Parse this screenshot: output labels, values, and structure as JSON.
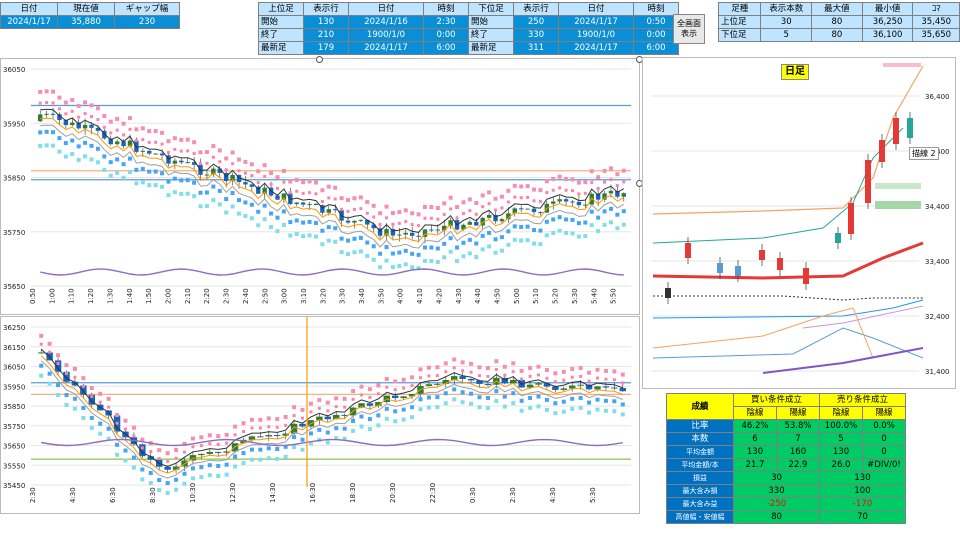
{
  "top_left": {
    "headers": [
      "日付",
      "現在値",
      "ギャップ幅"
    ],
    "values": [
      "2024/1/17",
      "35,880",
      "230"
    ]
  },
  "top_mid": {
    "headers": [
      "上位足",
      "表示行",
      "日付",
      "時刻",
      "下位足",
      "表示行",
      "日付",
      "時刻"
    ],
    "rows": [
      [
        "開始",
        "130",
        "2024/1/16",
        "2:30",
        "開始",
        "250",
        "2024/1/17",
        "0:50"
      ],
      [
        "終了",
        "210",
        "1900/1/0",
        "0:00",
        "終了",
        "330",
        "1900/1/0",
        "0:00"
      ],
      [
        "最新足",
        "179",
        "2024/1/17",
        "6:00",
        "最新足",
        "311",
        "2024/1/17",
        "6:00"
      ]
    ]
  },
  "fullscreen_button": "全画面表示",
  "top_right": {
    "headers": [
      "足種",
      "表示本数",
      "最大値",
      "最小値",
      "ｺﾏ"
    ],
    "rows": [
      [
        "上位足",
        "30",
        "80",
        "36,250",
        "35,450"
      ],
      [
        "下位足",
        "5",
        "80",
        "36,100",
        "35,650"
      ]
    ]
  },
  "chart1": {
    "y_ticks": [
      "36050",
      "35950",
      "35850",
      "35750",
      "35650"
    ],
    "x_ticks": [
      "0:50",
      "1:00",
      "1:10",
      "1:20",
      "1:30",
      "1:40",
      "1:50",
      "2:00",
      "2:10",
      "2:20",
      "2:30",
      "2:40",
      "2:50",
      "3:00",
      "3:10",
      "3:20",
      "3:30",
      "3:40",
      "3:50",
      "4:00",
      "4:10",
      "4:20",
      "4:30",
      "4:40",
      "4:50",
      "5:00",
      "5:10",
      "5:20",
      "5:30",
      "5:40",
      "5:50"
    ]
  },
  "chart2": {
    "y_ticks": [
      "36250",
      "36150",
      "36050",
      "35950",
      "35850",
      "35750",
      "35650",
      "35550",
      "35450"
    ],
    "x_ticks": [
      "2:30",
      "4:30",
      "6:30",
      "8:30",
      "10:30",
      "12:30",
      "14:30",
      "16:30",
      "18:30",
      "20:30",
      "22:30",
      "0:30",
      "2:30",
      "4:30",
      "5:30"
    ]
  },
  "daily_chart": {
    "title": "日足",
    "y_ticks": [
      "36,400",
      "35,400",
      "34,400",
      "33,400",
      "32,400",
      "31,400"
    ],
    "tooltip": "描線 2"
  },
  "results": {
    "title": "成績",
    "buy_header": "買い条件成立",
    "sell_header": "売り条件成立",
    "sub": [
      "陰線",
      "陽線",
      "陰線",
      "陽線"
    ],
    "rows": [
      {
        "label": "比率",
        "values": [
          "46.2%",
          "53.8%",
          "100.0%",
          "0.0%"
        ]
      },
      {
        "label": "本数",
        "values": [
          "6",
          "7",
          "5",
          "0"
        ]
      },
      {
        "label": "平均金額",
        "values": [
          "130",
          "160",
          "130",
          "0"
        ]
      },
      {
        "label": "平均金額/本",
        "values": [
          "21.7",
          "22.9",
          "26.0",
          "#DIV/0!"
        ]
      }
    ],
    "rows2": [
      {
        "label": "損益",
        "values": [
          "30",
          "130"
        ]
      },
      {
        "label": "最大含み損",
        "values": [
          "330",
          "100"
        ]
      },
      {
        "label": "最大含み益",
        "values": [
          "-250",
          "-170"
        ]
      },
      {
        "label": "高値幅・安値幅",
        "values": [
          "80",
          "70"
        ]
      }
    ]
  }
}
